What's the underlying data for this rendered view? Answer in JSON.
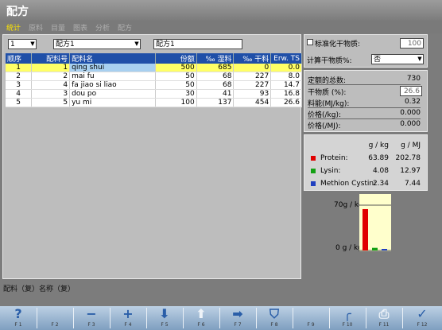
{
  "title": "配方",
  "tabs": [
    {
      "label": "统计",
      "active": true
    },
    {
      "label": "原料",
      "active": false
    },
    {
      "label": "目量",
      "active": false
    },
    {
      "label": "图表",
      "active": false
    },
    {
      "label": "分析",
      "active": false
    },
    {
      "label": "配方",
      "active": false
    }
  ],
  "left": {
    "number_select": "1",
    "recipe_select": "配方1",
    "recipe_name": "配方1",
    "columns": [
      "顺序",
      "配料号",
      "配料名",
      "份额",
      "‰ 湿料",
      "‰ 干料",
      "Erw. TS"
    ],
    "rows": [
      {
        "seq": "1",
        "no": "1",
        "name": "qing shui",
        "share": "500",
        "wet": "685",
        "dry": "0",
        "ts": "0.0"
      },
      {
        "seq": "2",
        "no": "2",
        "name": "mai fu",
        "share": "50",
        "wet": "68",
        "dry": "227",
        "ts": "8.0"
      },
      {
        "seq": "3",
        "no": "4",
        "name": "fa jiao si liao",
        "share": "50",
        "wet": "68",
        "dry": "227",
        "ts": "14.7"
      },
      {
        "seq": "4",
        "no": "3",
        "name": "dou po",
        "share": "30",
        "wet": "41",
        "dry": "93",
        "ts": "16.8"
      },
      {
        "seq": "5",
        "no": "5",
        "name": "yu mi",
        "share": "100",
        "wet": "137",
        "dry": "454",
        "ts": "26.6"
      }
    ]
  },
  "status_text": "配料（复）名称（复）",
  "right": {
    "std_label": "标准化干物质:",
    "std_value": "100",
    "calc_label": "计算干物质%:",
    "calc_value": "否",
    "stats": [
      {
        "label": "定额的总数:",
        "value": "730"
      },
      {
        "label": "干物质 (%):",
        "value": "26.6"
      },
      {
        "label": "料能(MJ/kg):",
        "value": "0.32"
      },
      {
        "label": "价格(/kg):",
        "value": "0.000"
      },
      {
        "label": "价格(/MJ):",
        "value": "0.000"
      }
    ],
    "nutrients": {
      "header1": "g / kg",
      "header2": "g / MJ",
      "items": [
        {
          "name": "Protein:",
          "gkg": "63.89",
          "gmj": "202.78",
          "color": "#e00000"
        },
        {
          "name": "Lysin:",
          "gkg": "4.08",
          "gmj": "12.97",
          "color": "#14a014"
        },
        {
          "name": "Methion Cystin:",
          "gkg": "2.34",
          "gmj": "7.44",
          "color": "#2040c0"
        }
      ]
    },
    "chart_data": {
      "type": "bar",
      "categories": [
        "Protein",
        "Lysin",
        "Methion Cystin"
      ],
      "values": [
        63.89,
        4.08,
        2.34
      ],
      "colors": [
        "#e00000",
        "#14a014",
        "#2040c0"
      ],
      "ytop_label": "70g / kg",
      "ybottom_label": "0 g / kg",
      "ylim": [
        0,
        70
      ]
    }
  },
  "fkeys": [
    {
      "icon": "?",
      "label": "F 1",
      "dim": false,
      "name": "help-icon"
    },
    {
      "icon": "",
      "label": "F 2",
      "dim": false,
      "name": "blank-icon"
    },
    {
      "icon": "−",
      "label": "F 3",
      "dim": false,
      "name": "minus-icon"
    },
    {
      "icon": "+",
      "label": "F 4",
      "dim": false,
      "name": "plus-icon"
    },
    {
      "icon": "⬇",
      "label": "F 5",
      "dim": false,
      "name": "arrow-down-icon"
    },
    {
      "icon": "⬆",
      "label": "F 6",
      "dim": true,
      "name": "arrow-up-icon"
    },
    {
      "icon": "➡",
      "label": "F 7",
      "dim": false,
      "name": "arrow-right-icon"
    },
    {
      "icon": "⛉",
      "label": "F 8",
      "dim": false,
      "name": "mixer-icon"
    },
    {
      "icon": "",
      "label": "F 9",
      "dim": false,
      "name": "blank-icon"
    },
    {
      "icon": "╭",
      "label": "F 10",
      "dim": false,
      "name": "curve-icon"
    },
    {
      "icon": "⎙",
      "label": "F 11",
      "dim": true,
      "name": "printer-icon"
    },
    {
      "icon": "✓",
      "label": "F 12",
      "dim": false,
      "name": "check-icon"
    }
  ]
}
